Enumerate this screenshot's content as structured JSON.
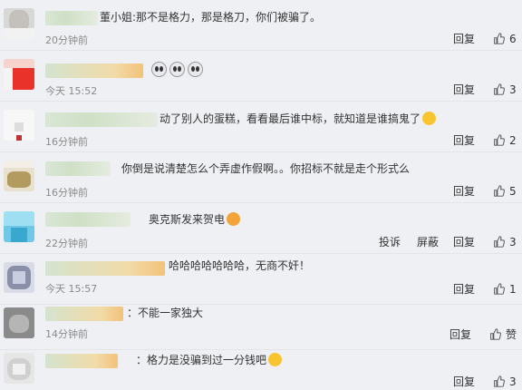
{
  "comments": [
    {
      "text": "董小姐:那不是格力，那是格刀，你们被骗了。",
      "time": "20分钟前",
      "reply": "回复",
      "likes": "6"
    },
    {
      "text": "",
      "time": "今天 15:52",
      "reply": "回复",
      "likes": "3"
    },
    {
      "text": "动了别人的蛋糕，看看最后谁中标，就知道是谁搞鬼了",
      "time": "16分钟前",
      "reply": "回复",
      "likes": "2"
    },
    {
      "text": "你倒是说清楚怎么个弄虚作假啊。。你招标不就是走个形式么",
      "time": "16分钟前",
      "reply": "回复",
      "likes": "5"
    },
    {
      "text": "奥克斯发来贺电",
      "time": "22分钟前",
      "report": "投诉",
      "block": "屏蔽",
      "reply": "回复",
      "likes": "3"
    },
    {
      "text": "哈哈哈哈哈哈哈，无商不奸！",
      "time": "今天 15:57",
      "reply": "回复",
      "likes": "1"
    },
    {
      "text": "：不能一家独大",
      "time": "14分钟前",
      "reply": "回复",
      "likes": "赞"
    },
    {
      "text": "：格力是没骗到过一分钱吧",
      "time": "",
      "reply": "回复",
      "likes": "3"
    }
  ]
}
